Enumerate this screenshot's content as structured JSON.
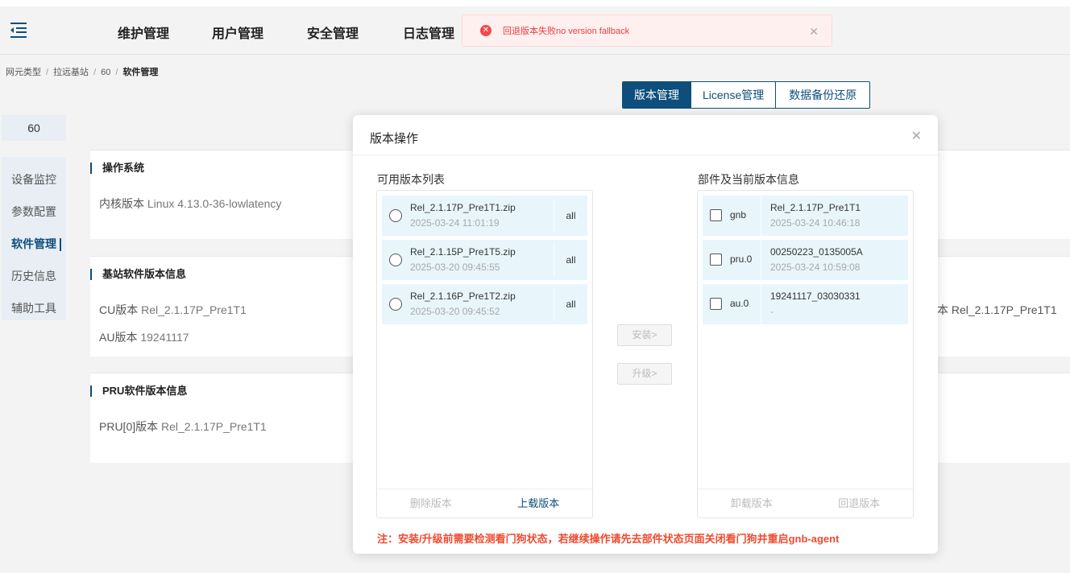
{
  "header": {
    "nav": [
      "维护管理",
      "用户管理",
      "安全管理",
      "日志管理"
    ]
  },
  "toast": {
    "message": "回退版本失败no version fallback",
    "icon": "error-circle-icon",
    "close": "✕"
  },
  "breadcrumb": [
    "网元类型",
    "拉远基站",
    "60",
    "软件管理"
  ],
  "tabs": [
    "版本管理",
    "License管理",
    "数据备份还原"
  ],
  "device": {
    "id": "60"
  },
  "sidebar": {
    "items": [
      "设备监控",
      "参数配置",
      "软件管理",
      "历史信息",
      "辅助工具"
    ],
    "active_index": 2
  },
  "cards": {
    "os": {
      "title": "操作系统",
      "kernel_label": "内核版本",
      "kernel_value": "Linux 4.13.0-36-lowlatency"
    },
    "bs": {
      "title": "基站软件版本信息",
      "cu_label": "CU版本",
      "cu_value": "Rel_2.1.17P_Pre1T1",
      "au_label": "AU版本",
      "au_value": "19241117",
      "right_label": "本",
      "right_value": "Rel_2.1.17P_Pre1T1"
    },
    "pru": {
      "title": "PRU软件版本信息",
      "pru_label": "PRU[0]版本",
      "pru_value": "Rel_2.1.17P_Pre1T1"
    }
  },
  "modal": {
    "title": "版本操作",
    "close": "✕",
    "left_label": "可用版本列表",
    "right_label": "部件及当前版本信息",
    "versions": [
      {
        "name": "Rel_2.1.17P_Pre1T1.zip",
        "time": "2025-03-24 11:01:19",
        "tag": "all"
      },
      {
        "name": "Rel_2.1.15P_Pre1T5.zip",
        "time": "2025-03-20 09:45:55",
        "tag": "all"
      },
      {
        "name": "Rel_2.1.16P_Pre1T2.zip",
        "time": "2025-03-20 09:45:52",
        "tag": "all"
      }
    ],
    "components": [
      {
        "name": "gnb",
        "version": "Rel_2.1.17P_Pre1T1",
        "time": "2025-03-24 10:46:18"
      },
      {
        "name": "pru.0",
        "version": "00250223_0135005A",
        "time": "2025-03-24 10:59:08"
      },
      {
        "name": "au.0",
        "version": "19241117_03030331",
        "time": "-"
      }
    ],
    "install_btn": "安装>",
    "upgrade_btn": "升级>",
    "delete_btn": "删除版本",
    "upload_btn": "上载版本",
    "uninstall_btn": "卸载版本",
    "rollback_btn": "回退版本",
    "note": "注：安装/升级前需要检测看门狗状态，若继续操作请先去部件状态页面关闭看门狗并重启gnb-agent"
  },
  "colors": {
    "primary": "#0e4e7c",
    "error": "#ec3c3c",
    "note": "#f04a2f",
    "item_bg": "#e8f6fc"
  }
}
